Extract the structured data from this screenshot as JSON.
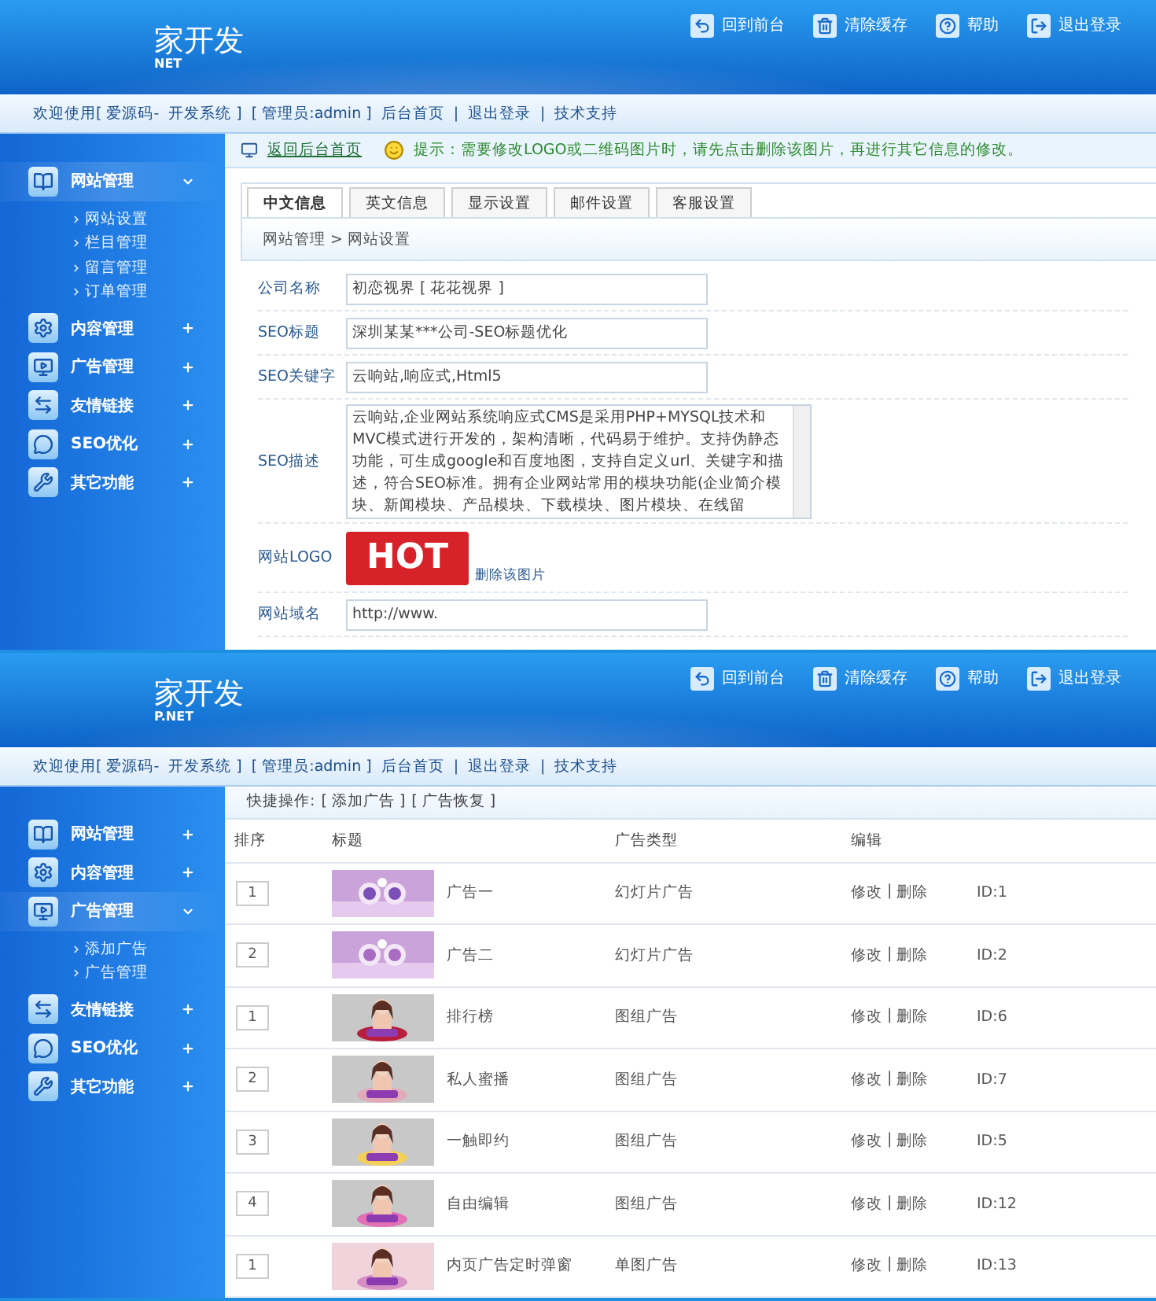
{
  "screens": [
    {
      "header": {
        "logo_text": "家开发",
        "logo_sub": "NET",
        "actions": [
          {
            "label": "回到前台",
            "kind": "back"
          },
          {
            "label": "清除缓存",
            "kind": "trash"
          },
          {
            "label": "帮助",
            "kind": "help"
          },
          {
            "label": "退出登录",
            "kind": "exit"
          }
        ]
      },
      "nav": {
        "welcome": "欢迎使用[ 爱源码-",
        "system": "开发系统 ]",
        "admin": "[ 管理员:admin ]",
        "links": [
          "后台首页",
          "退出登录",
          "技术支持"
        ],
        "separator": "|"
      },
      "sidebar": [
        {
          "label": "网站管理",
          "kind": "book",
          "expanded": true,
          "children": [
            "网站设置",
            "栏目管理",
            "留言管理",
            "订单管理"
          ]
        },
        {
          "label": "内容管理",
          "kind": "gear",
          "expanded": false
        },
        {
          "label": "广告管理",
          "kind": "screen",
          "expanded": false
        },
        {
          "label": "友情链接",
          "kind": "link",
          "expanded": false
        },
        {
          "label": "SEO优化",
          "kind": "chat",
          "expanded": false
        },
        {
          "label": "其它功能",
          "kind": "tool",
          "expanded": false
        }
      ],
      "content": {
        "kind": "settings",
        "back_link": "返回后台首页",
        "tip": "提示：需要修改LOGO或二维码图片时，请先点击删除该图片，再进行其它信息的修改。",
        "tabs": [
          {
            "label": "中文信息",
            "selected": true
          },
          {
            "label": "英文信息",
            "selected": false
          },
          {
            "label": "显示设置",
            "selected": false
          },
          {
            "label": "邮件设置",
            "selected": false
          },
          {
            "label": "客服设置",
            "selected": false
          }
        ],
        "breadcrumb": "网站管理 > 网站设置",
        "fields": [
          {
            "kind": "text",
            "label": "公司名称",
            "value": "初恋视界 [ 花花视界 ]"
          },
          {
            "kind": "text",
            "label": "SEO标题",
            "value": "深圳某某***公司-SEO标题优化"
          },
          {
            "kind": "text",
            "label": "SEO关键字",
            "value": "云响站,响应式,Html5"
          },
          {
            "kind": "textarea",
            "label": "SEO描述",
            "value": "云响站,企业网站系统响应式CMS是采用PHP+MYSQL技术和MVC模式进行开发的，架构清晰，代码易于维护。支持伪静态功能，可生成google和百度地图，支持自定义url、关键字和描述，符合SEO标准。拥有企业网站常用的模块功能(企业简介模块、新闻模块、产品模块、下载模块、图片模块、在线留"
          },
          {
            "label": "网站LOGO",
            "image_text": "HOT",
            "action": "删除该图片"
          },
          {
            "kind": "text",
            "label": "网站域名",
            "value": "http://www."
          }
        ]
      }
    },
    {
      "header": {
        "logo_text": "家开发",
        "logo_sub": "P.NET",
        "actions": [
          {
            "label": "回到前台",
            "kind": "back"
          },
          {
            "label": "清除缓存",
            "kind": "trash"
          },
          {
            "label": "帮助",
            "kind": "help"
          },
          {
            "label": "退出登录",
            "kind": "exit"
          }
        ]
      },
      "nav": {
        "welcome": "欢迎使用[ 爱源码-",
        "system": "开发系统 ]",
        "admin": "[ 管理员:admin ]",
        "links": [
          "后台首页",
          "退出登录",
          "技术支持"
        ],
        "separator": "|"
      },
      "sidebar": [
        {
          "label": "网站管理",
          "kind": "book",
          "expanded": false
        },
        {
          "label": "内容管理",
          "kind": "gear",
          "expanded": false
        },
        {
          "label": "广告管理",
          "kind": "screen",
          "expanded": true,
          "children": [
            "添加广告",
            "广告管理"
          ]
        },
        {
          "label": "友情链接",
          "kind": "link",
          "expanded": false
        },
        {
          "label": "SEO优化",
          "kind": "chat",
          "expanded": false
        },
        {
          "label": "其它功能",
          "kind": "tool",
          "expanded": false
        }
      ],
      "content": {
        "kind": "list",
        "quick_label": "快捷操作:",
        "quick_links": [
          "[ 添加广告 ]",
          "[ 广告恢复 ]"
        ],
        "action_separator": "|",
        "columns": [
          "排序",
          "标题",
          "广告类型",
          "编辑"
        ],
        "rows": [
          {
            "order": "1",
            "title": "广告一",
            "type": "幻灯片广告",
            "actions": [
              "修改",
              "删除"
            ],
            "id": "ID:1"
          },
          {
            "order": "2",
            "title": "广告二",
            "type": "幻灯片广告",
            "actions": [
              "修改",
              "删除"
            ],
            "id": "ID:2"
          },
          {
            "order": "1",
            "title": "排行榜",
            "type": "图组广告",
            "actions": [
              "修改",
              "删除"
            ],
            "id": "ID:6"
          },
          {
            "order": "2",
            "title": "私人蜜播",
            "type": "图组广告",
            "actions": [
              "修改",
              "删除"
            ],
            "id": "ID:7"
          },
          {
            "order": "3",
            "title": "一触即约",
            "type": "图组广告",
            "actions": [
              "修改",
              "删除"
            ],
            "id": "ID:5"
          },
          {
            "order": "4",
            "title": "自由编辑",
            "type": "图组广告",
            "actions": [
              "修改",
              "删除"
            ],
            "id": "ID:12"
          },
          {
            "order": "1",
            "title": "内页广告定时弹窗",
            "type": "单图广告",
            "actions": [
              "修改",
              "删除"
            ],
            "id": "ID:13"
          }
        ]
      }
    }
  ]
}
